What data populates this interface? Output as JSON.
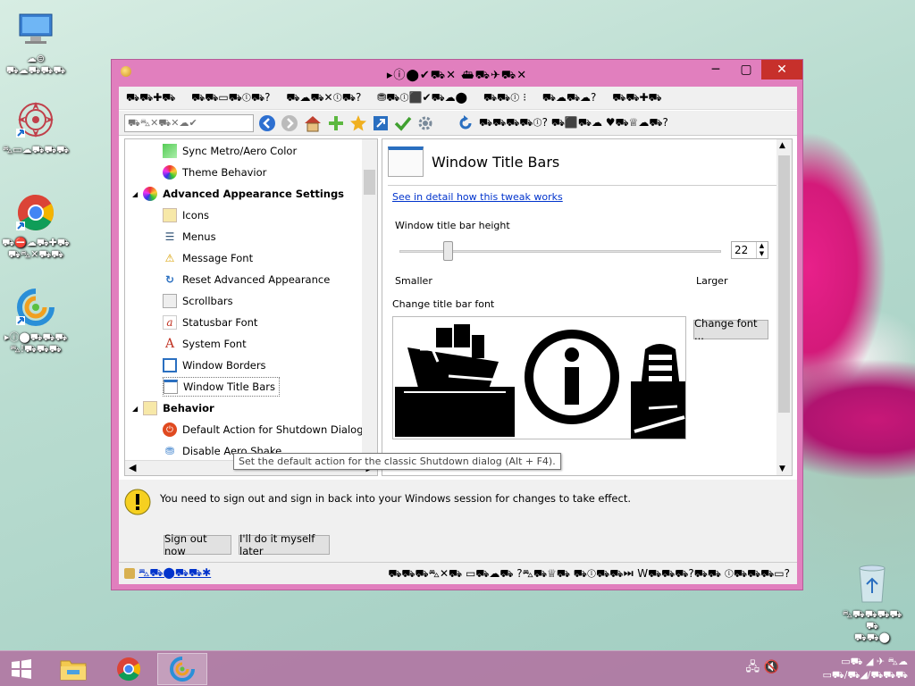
{
  "desktop": {
    "icons": [
      {
        "name": "this-pc",
        "label1": "☁⊜",
        "label2": "⛟☁⛟⛟⛟"
      },
      {
        "name": "app-shortcut-1",
        "label1": "⛍▭☁⛟⛟⛟",
        "label2": ""
      },
      {
        "name": "chrome",
        "label1": "⛟⛔☁⛟✚⛟",
        "label2": "⛟⛍✕⛟⛟"
      },
      {
        "name": "winaero-tweaker",
        "label1": "▸ⓘ⬤⛟⛟⛟",
        "label2": "⛍!⛟⛟⛟"
      }
    ],
    "recycle_bin": {
      "label1": "⛍⛟⛟⛟⛟⛟",
      "label2": "⛟⛟⬤"
    }
  },
  "taskbar": {
    "tray_icons": "🖧 🔇",
    "time": "▭⛟ ◢ ✈ ⛍☁",
    "date": "▭⛟/⛟◢/⛟⛟⛟"
  },
  "window": {
    "title": "▸ⓘ⬤✔⛟✕ ⛴⛟✈⛟✕",
    "minimize": "─",
    "maximize": "▢",
    "close": "✕",
    "menu": [
      "⛟⛟✚⛟",
      "⛟⛟▭⛟ⓘ⛟?",
      "⛟☁⛟✕ⓘ⛟?",
      "⛃⛟ⓘ⬛✔⛟☁⬤",
      "⛟⛟ⓘ ⁝",
      "⛟☁⛟☁?",
      "⛟⛟✚⛟"
    ],
    "toolbar_texts": {
      "search_placeholder": "⛟⛍✕⛟✕☁✔",
      "right_text": "⛟⛟⛟⛟ⓘ? ⛟⬛⛟☁ ♥⛟♕☁⛟?"
    },
    "tree": {
      "items": [
        {
          "label": "Sync Metro/Aero Color",
          "type": "child",
          "icon": "sync-color-icon"
        },
        {
          "label": "Theme Behavior",
          "type": "child",
          "icon": "theme-icon"
        },
        {
          "label": "Advanced Appearance Settings",
          "type": "cat",
          "icon": "appearance-icon"
        },
        {
          "label": "Icons",
          "type": "child",
          "icon": "icons-icon"
        },
        {
          "label": "Menus",
          "type": "child",
          "icon": "menus-icon"
        },
        {
          "label": "Message Font",
          "type": "child",
          "icon": "warning-icon"
        },
        {
          "label": "Reset Advanced Appearance",
          "type": "child",
          "icon": "reset-icon"
        },
        {
          "label": "Scrollbars",
          "type": "child",
          "icon": "scrollbars-icon"
        },
        {
          "label": "Statusbar Font",
          "type": "child",
          "icon": "font-a-icon"
        },
        {
          "label": "System Font",
          "type": "child",
          "icon": "font-A-icon"
        },
        {
          "label": "Window Borders",
          "type": "child",
          "icon": "borders-icon"
        },
        {
          "label": "Window Title Bars",
          "type": "child",
          "icon": "title-bars-icon",
          "selected": true
        },
        {
          "label": "Behavior",
          "type": "cat",
          "icon": "behavior-icon"
        },
        {
          "label": "Default Action for Shutdown Dialog",
          "type": "child",
          "icon": "shutdown-icon"
        },
        {
          "label": "Disable Aero Shake",
          "type": "child",
          "icon": "shake-icon"
        }
      ]
    },
    "panel": {
      "heading": "Window Title Bars",
      "detail_link": "See in detail how this tweak works",
      "height_label": "Window title bar height",
      "height_value": "22",
      "slider_fraction": 0.14,
      "min_label": "Smaller",
      "max_label": "Larger",
      "font_label": "Change title bar font",
      "change_font_button": "Change font ..."
    },
    "tooltip": "Set the default action for the classic Shutdown dialog (Alt + F4).",
    "notice": {
      "text": "You need to sign out and sign in back into your Windows session for changes to take effect.",
      "sign_out_button": "Sign out now",
      "later_button": "I'll do it myself later"
    },
    "statusbar": {
      "left": "⛍⛟⬤⛟⛟✱",
      "right": "⛟⛟⛟⛍✕⛟ ▭⛟☁⛟ ?⛍⛟♕⛟ ⛟ⓘ⛟⛟⏭ W⛟⛟⛟?⛟⛟ ⓘ⛟⛟⛟▭?"
    }
  }
}
